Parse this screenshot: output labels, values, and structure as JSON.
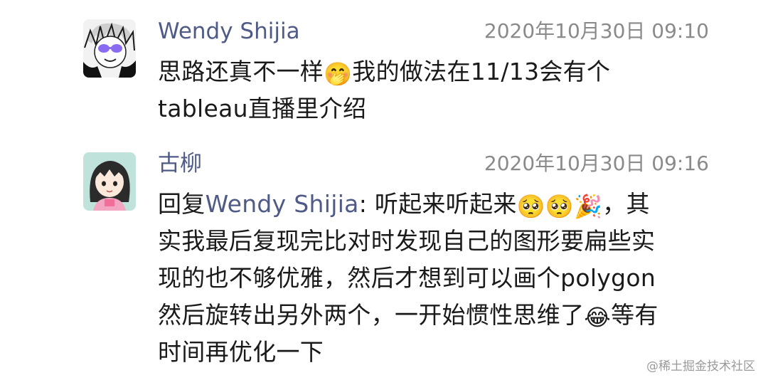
{
  "messages": [
    {
      "sender": "Wendy Shijia",
      "timestamp": "2020年10月30日  09:10",
      "text_part1": "思路还真不一样",
      "emoji1": "🤭",
      "text_part2": "我的做法在11/13会有个\ntableau直播里介绍",
      "avatar_icon": "user-avatar-wendy"
    },
    {
      "sender": "古柳",
      "timestamp": "2020年10月30日  09:16",
      "reply_prefix": "回复",
      "mention": "Wendy Shijia",
      "text_part1": ": 听起来听起来",
      "emoji1": "🥺",
      "emoji2": "🥺",
      "emoji3": "🎉",
      "text_part2": "，其\n实我最后复现完比对时发现自己的图形要扁些实\n现的也不够优雅，然后才想到可以画个polygon\n然后旋转出另外两个，一开始惯性思维了",
      "emoji4": "😂",
      "text_part3": "等有\n时间再优化一下",
      "avatar_icon": "user-avatar-guliu"
    }
  ],
  "watermark": "@稀土掘金技术社区"
}
